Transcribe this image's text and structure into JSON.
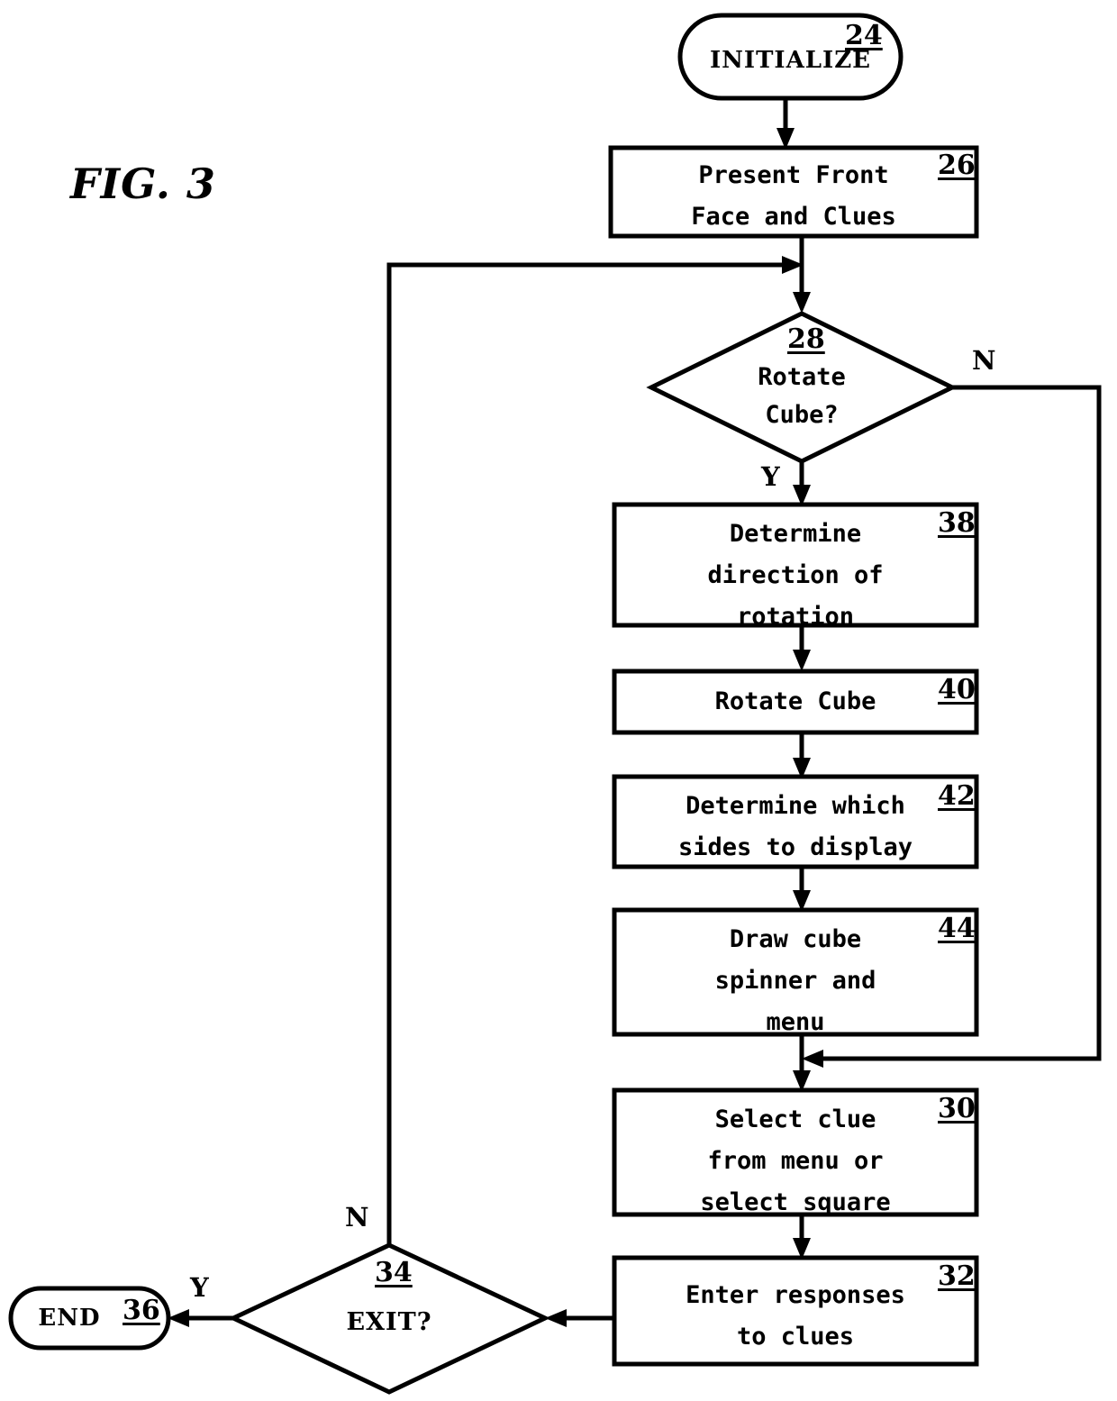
{
  "figure": {
    "title": "FIG. 3"
  },
  "nodes": {
    "initialize": {
      "label": "INITIALIZE",
      "ref": "24",
      "shape": "terminal"
    },
    "present_front": {
      "label": "Present Front\nFace and Clues",
      "ref": "26",
      "shape": "process"
    },
    "rotate_cube_decision": {
      "label": "Rotate\nCube?",
      "ref": "28",
      "shape": "decision",
      "yes_label": "Y",
      "no_label": "N"
    },
    "determine_direction": {
      "label": "Determine\ndirection of\nrotation",
      "ref": "38",
      "shape": "process"
    },
    "rotate_cube": {
      "label": "Rotate Cube",
      "ref": "40",
      "shape": "process"
    },
    "determine_sides": {
      "label": "Determine which\nsides to display",
      "ref": "42",
      "shape": "process"
    },
    "draw_cube": {
      "label": "Draw cube\nspinner and\nmenu",
      "ref": "44",
      "shape": "process"
    },
    "select_clue": {
      "label": "Select clue\nfrom menu or\nselect square",
      "ref": "30",
      "shape": "process"
    },
    "enter_responses": {
      "label": "Enter responses\nto clues",
      "ref": "32",
      "shape": "process"
    },
    "exit_decision": {
      "label": "EXIT?",
      "ref": "34",
      "shape": "decision",
      "yes_label": "Y",
      "no_label": "N"
    },
    "end": {
      "label": "END",
      "ref": "36",
      "shape": "terminal"
    }
  },
  "colors": {
    "stroke": "#000000",
    "background": "#ffffff"
  }
}
